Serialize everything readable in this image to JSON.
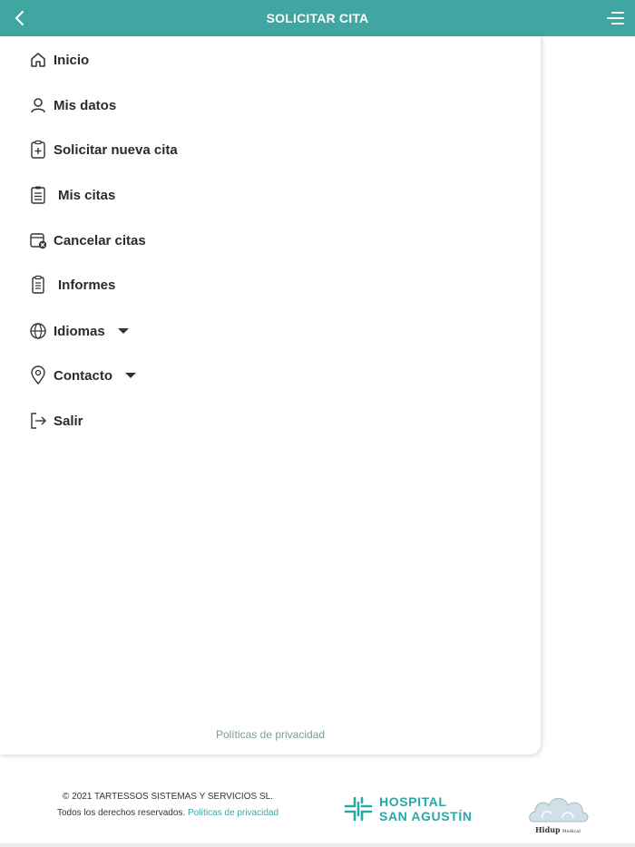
{
  "header": {
    "title": "SOLICITAR CITA",
    "bg_color": "#3fa6a2"
  },
  "nav": {
    "items": [
      {
        "label": "Inicio",
        "icon": "home-icon"
      },
      {
        "label": "Mis datos",
        "icon": "user-icon"
      },
      {
        "label": "Solicitar nueva cita",
        "icon": "clipboard-plus-icon"
      },
      {
        "label": "Mis citas",
        "icon": "clipboard-list-icon"
      },
      {
        "label": "Cancelar citas",
        "icon": "calendar-cancel-icon"
      },
      {
        "label": "Informes",
        "icon": "report-icon"
      },
      {
        "label": "Idiomas",
        "icon": "globe-icon",
        "has_dropdown": true
      },
      {
        "label": "Contacto",
        "icon": "location-pin-icon",
        "has_dropdown": true
      },
      {
        "label": "Salir",
        "icon": "logout-icon"
      }
    ]
  },
  "drawer_footer": {
    "privacy_link": "Políticas de privacidad"
  },
  "footer": {
    "copyright": "© 2021 TARTESSOS SISTEMAS Y SERVICIOS SL.",
    "rights": "Todos los derechos reservados.",
    "privacy_link": "Políticas de privacidad",
    "hospital_line1": "HOSPITAL",
    "hospital_line2": "SAN AGUSTÍN",
    "hidup_name": "Hidup",
    "hidup_sub": "Medical"
  },
  "colors": {
    "accent": "#3fa6a2",
    "text": "#2b2b2b"
  }
}
